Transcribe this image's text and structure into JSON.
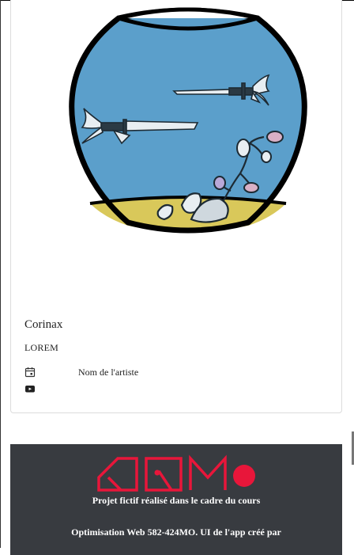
{
  "card": {
    "title": "Corinax",
    "subtitle": "LOREM",
    "artist_label": "Nom de l'artiste",
    "icons": [
      "calendar-icon",
      "video-icon"
    ]
  },
  "footer": {
    "line1": "Projet fictif réalisé dans le cadre du cours",
    "line2": "Optimisation Web 582-424MO. UI de l'app créé par",
    "logo_color": "#e8163a",
    "background": "#383b40"
  },
  "colors": {
    "water": "#5b9fcb",
    "sand": "#d9c85a",
    "outline": "#000000"
  }
}
